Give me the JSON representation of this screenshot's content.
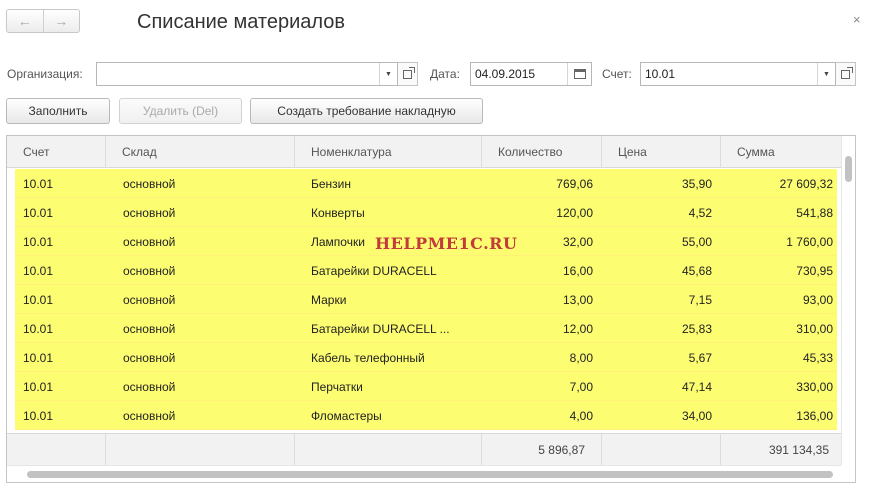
{
  "window": {
    "title": "Списание материалов",
    "nav": {
      "back_icon": "←",
      "forward_icon": "→"
    },
    "close_icon": "×"
  },
  "form": {
    "organization_label": "Организация:",
    "organization_value": "",
    "date_label": "Дата:",
    "date_value": "04.09.2015",
    "account_label": "Счет:",
    "account_value": "10.01"
  },
  "toolbar": {
    "fill_label": "Заполнить",
    "delete_label": "Удалить (Del)",
    "create_label": "Создать требование накладную"
  },
  "table": {
    "columns": [
      "Счет",
      "Склад",
      "Номенклатура",
      "Количество",
      "Цена",
      "Сумма"
    ],
    "rows": [
      [
        "10.01",
        "основной",
        "Бензин",
        "769,06",
        "35,90",
        "27 609,32"
      ],
      [
        "10.01",
        "основной",
        "Конверты",
        "120,00",
        "4,52",
        "541,88"
      ],
      [
        "10.01",
        "основной",
        "Лампочки",
        "32,00",
        "55,00",
        "1 760,00"
      ],
      [
        "10.01",
        "основной",
        "Батарейки DURACELL",
        "16,00",
        "45,68",
        "730,95"
      ],
      [
        "10.01",
        "основной",
        "Марки",
        "13,00",
        "7,15",
        "93,00"
      ],
      [
        "10.01",
        "основной",
        "Батарейки DURACELL ...",
        "12,00",
        "25,83",
        "310,00"
      ],
      [
        "10.01",
        "основной",
        "Кабель телефонный",
        "8,00",
        "5,67",
        "45,33"
      ],
      [
        "10.01",
        "основной",
        "Перчатки",
        "7,00",
        "47,14",
        "330,00"
      ],
      [
        "10.01",
        "основной",
        "Фломастеры",
        "4,00",
        "34,00",
        "136,00"
      ]
    ],
    "totals": {
      "quantity": "5 896,87",
      "sum": "391 134,35"
    },
    "highlight_color": "#fdfd71"
  },
  "watermark": "HELPME1C.RU"
}
